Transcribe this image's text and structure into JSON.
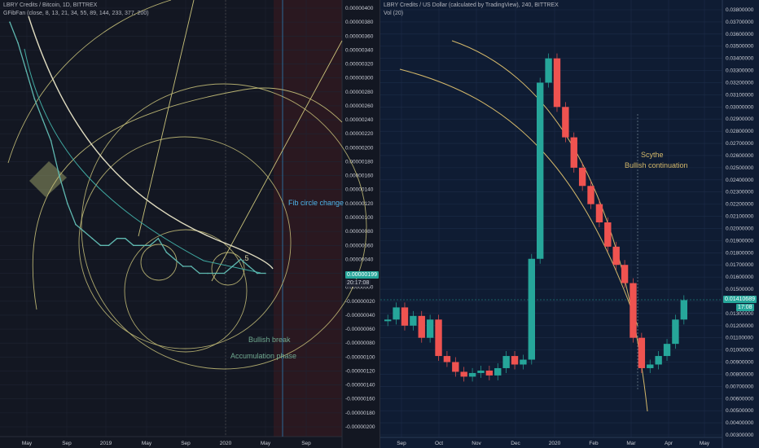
{
  "left_chart": {
    "title": "LBRY Credits / Bitcoin, 1D, BITTREX",
    "indicator": "GFibFan (close, 8, 13, 21, 34, 55, 89, 144, 233, 377, 200)",
    "price_tag": "0.00000199",
    "countdown_tag": "20:17:08",
    "annotations": {
      "fib_circle": "Fib circle change",
      "bullish_break": "Bullish break",
      "accumulation": "Accumulation phase",
      "fib_label": ".5"
    },
    "colors": {
      "background": "#131722",
      "future_shade": "#2a1820",
      "fib": "#c9c27a",
      "price": "#5fb8b0",
      "annot": "#6fa88f",
      "tag": "#26a69a"
    }
  },
  "right_chart": {
    "title": "LBRY Credits / US Dollar (calculated by TradingView), 240, BITTREX",
    "indicator": "Vol (20)",
    "price_tag": "0.01410689",
    "countdown_tag": "17:08",
    "annotations": {
      "scythe": "Scythe",
      "continuation": "Bullish continuation"
    },
    "colors": {
      "background": "#0f1c33",
      "arc": "#d4b86a",
      "up": "#26a69a",
      "down": "#ef5350",
      "tag": "#26a69a"
    }
  },
  "chart_data": [
    {
      "type": "line",
      "title": "LBRY Credits / Bitcoin, 1D, BITTREX",
      "y_tick_labels": [
        "0.00000400",
        "0.00000380",
        "0.00000360",
        "0.00000340",
        "0.00000320",
        "0.00000300",
        "0.00000280",
        "0.00000260",
        "0.00000240",
        "0.00000220",
        "0.00000200",
        "0.00000180",
        "0.00000160",
        "0.00000140",
        "0.00000120",
        "0.00000100",
        "0.00000080",
        "0.00000060",
        "0.00000040",
        "0.00000020",
        "0.00000000",
        "-0.00000020",
        "-0.00000040",
        "-0.00000060",
        "-0.00000080",
        "-0.00000100",
        "-0.00000120",
        "-0.00000140",
        "-0.00000160",
        "-0.00000180",
        "-0.00000200"
      ],
      "x_tick_labels": [
        "May",
        "Sep",
        "2019",
        "May",
        "Sep",
        "2020",
        "May",
        "Sep"
      ],
      "ylim": [
        -2e-06,
        4e-06
      ],
      "series": [
        {
          "values": [
            3.8e-06,
            3.5e-06,
            3.1e-06,
            2.7e-06,
            2.4e-06,
            2.1e-06,
            1.6e-06,
            1.2e-06,
            9e-07,
            8e-07,
            7e-07,
            6e-07,
            6e-07,
            7e-07,
            7e-07,
            6e-07,
            6e-07,
            6e-07,
            7e-07,
            5e-07,
            4e-07,
            3e-07,
            3e-07,
            2e-07,
            2e-07,
            2e-07,
            2e-07,
            3e-07,
            4e-07,
            3e-07,
            2e-07,
            2e-07
          ]
        }
      ]
    },
    {
      "type": "line",
      "title": "LBRY Credits / US Dollar (calculated by TradingView), 240, BITTREX",
      "y_tick_labels": [
        "0.03800000",
        "0.03700000",
        "0.03600000",
        "0.03500000",
        "0.03400000",
        "0.03300000",
        "0.03200000",
        "0.03100000",
        "0.03000000",
        "0.02900000",
        "0.02800000",
        "0.02700000",
        "0.02600000",
        "0.02500000",
        "0.02400000",
        "0.02300000",
        "0.02200000",
        "0.02100000",
        "0.02000000",
        "0.01900000",
        "0.01800000",
        "0.01700000",
        "0.01600000",
        "0.01500000",
        "0.01400000",
        "0.01300000",
        "0.01200000",
        "0.01100000",
        "0.01000000",
        "0.00900000",
        "0.00800000",
        "0.00700000",
        "0.00600000",
        "0.00500000",
        "0.00400000",
        "0.00300000"
      ],
      "x_tick_labels": [
        "Sep",
        "Oct",
        "Nov",
        "Dec",
        "2020",
        "Feb",
        "Mar",
        "Apr",
        "May"
      ],
      "ylim": [
        0.003,
        0.038
      ],
      "series": [
        {
          "values": [
            0.0125,
            0.0135,
            0.012,
            0.0128,
            0.011,
            0.0125,
            0.0095,
            0.009,
            0.0082,
            0.0078,
            0.0081,
            0.0083,
            0.0079,
            0.0085,
            0.0095,
            0.0088,
            0.0092,
            0.0175,
            0.032,
            0.034,
            0.03,
            0.0275,
            0.025,
            0.0235,
            0.022,
            0.0205,
            0.0185,
            0.017,
            0.0155,
            0.011,
            0.0085,
            0.0088,
            0.0095,
            0.0105,
            0.0125,
            0.0141
          ]
        }
      ]
    }
  ]
}
